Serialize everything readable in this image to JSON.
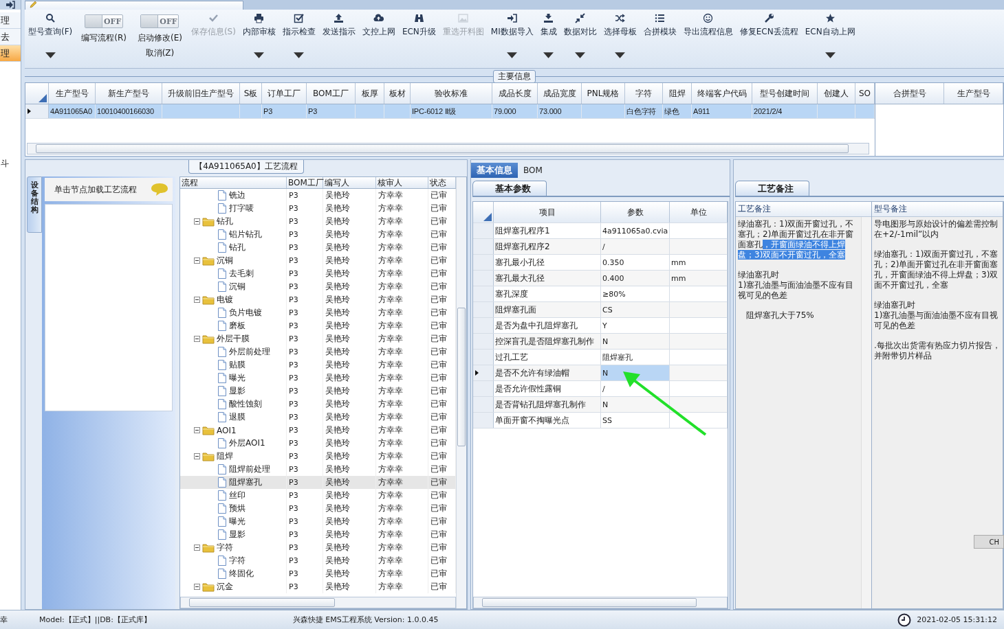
{
  "side_strip": {
    "items": [
      {
        "label": "理",
        "selected": false
      },
      {
        "label": "去",
        "selected": false
      },
      {
        "label": "理",
        "selected": true
      }
    ],
    "lower_label": "斗"
  },
  "toolbar": {
    "items": [
      {
        "kind": "button",
        "label": "型号查询(F)",
        "dropdown": true,
        "disabled": false
      },
      {
        "kind": "toggle",
        "switch_text": "OFF",
        "on": false,
        "label": "编写流程(R)"
      },
      {
        "kind": "toggle",
        "switch_text": "OFF",
        "on": false,
        "label": "启动修改(E)",
        "sublabel": "取消(Z)"
      },
      {
        "kind": "button",
        "label": "保存信息(S)",
        "dropdown": false,
        "disabled": true
      },
      {
        "kind": "button",
        "label": "内部审核",
        "dropdown": true,
        "disabled": false
      },
      {
        "kind": "button",
        "label": "指示检查",
        "dropdown": true,
        "disabled": false
      },
      {
        "kind": "button",
        "label": "发送指示",
        "dropdown": false,
        "disabled": false
      },
      {
        "kind": "button",
        "label": "文控上网",
        "dropdown": false,
        "disabled": false
      },
      {
        "kind": "button",
        "label": "ECN升级",
        "dropdown": false,
        "disabled": false
      },
      {
        "kind": "button",
        "label": "重选开料图",
        "dropdown": false,
        "disabled": true
      },
      {
        "kind": "button",
        "label": "MI数据导入",
        "dropdown": true,
        "disabled": false
      },
      {
        "kind": "button",
        "label": "集成",
        "dropdown": true,
        "disabled": false
      },
      {
        "kind": "button",
        "label": "数据对比",
        "dropdown": true,
        "disabled": false
      },
      {
        "kind": "button",
        "label": "选择母板",
        "dropdown": true,
        "disabled": false
      },
      {
        "kind": "button",
        "label": "合拼模块",
        "dropdown": false,
        "disabled": false
      },
      {
        "kind": "button",
        "label": "导出流程信息",
        "dropdown": false,
        "disabled": false
      },
      {
        "kind": "button",
        "label": "修复ECN丢流程",
        "dropdown": false,
        "disabled": false
      },
      {
        "kind": "button",
        "label": "ECN自动上网",
        "dropdown": true,
        "disabled": false
      }
    ]
  },
  "main_info": {
    "title": "主要信息",
    "row_selected": true,
    "columns": [
      {
        "label": "生产型号",
        "cell": "4A911065A0"
      },
      {
        "label": "新生产型号",
        "cell": "10010400166030"
      },
      {
        "label": "升级前旧生产型号"
      },
      {
        "label": "S板"
      },
      {
        "label": "订单工厂",
        "cell": "P3"
      },
      {
        "label": "BOM工厂",
        "cell": "P3"
      },
      {
        "label": "板厚"
      },
      {
        "label": "板材"
      },
      {
        "label": "验收标准",
        "cell": "IPC-6012 Ⅱ级"
      },
      {
        "label": "成品长度",
        "cell": "79.000"
      },
      {
        "label": "成品宽度",
        "cell": "73.000"
      },
      {
        "label": "PNL规格"
      },
      {
        "label": "字符",
        "cell": "白色字符"
      },
      {
        "label": "阻焊",
        "cell": "绿色"
      },
      {
        "label": "终端客户代码",
        "cell": "A911"
      },
      {
        "label": "型号创建时间",
        "cell": "2021/2/4"
      },
      {
        "label": "创建人"
      },
      {
        "label": "SO"
      }
    ],
    "merge_columns": [
      "合拼型号",
      "生产型号"
    ]
  },
  "flow": {
    "title": "【4A911065A0】工艺流程",
    "side_tab": "设备结构",
    "hint": "单击节点加载工艺流程",
    "columns": [
      "流程",
      "BOM工厂",
      "编写人",
      "核审人",
      "状态"
    ],
    "nodes": [
      {
        "kind": "step",
        "name": "铣边",
        "bom": "P3",
        "writer": "吴艳玲",
        "reviewer": "方幸幸",
        "status": "已审",
        "selected": false
      },
      {
        "kind": "step",
        "name": "打字唛",
        "bom": "P3",
        "writer": "吴艳玲",
        "reviewer": "方幸幸",
        "status": "已审",
        "selected": false
      },
      {
        "kind": "group",
        "name": "钻孔",
        "bom": "P3",
        "writer": "吴艳玲",
        "reviewer": "方幸幸",
        "status": "已审",
        "selected": false,
        "expanded": true,
        "children": [
          {
            "kind": "step",
            "name": "铝片钻孔",
            "bom": "P3",
            "writer": "吴艳玲",
            "reviewer": "方幸幸",
            "status": "已审",
            "selected": false
          },
          {
            "kind": "step",
            "name": "钻孔",
            "bom": "P3",
            "writer": "吴艳玲",
            "reviewer": "方幸幸",
            "status": "已审",
            "selected": false
          }
        ]
      },
      {
        "kind": "group",
        "name": "沉铜",
        "bom": "P3",
        "writer": "吴艳玲",
        "reviewer": "方幸幸",
        "status": "已审",
        "selected": false,
        "expanded": true,
        "children": [
          {
            "kind": "step",
            "name": "去毛刺",
            "bom": "P3",
            "writer": "吴艳玲",
            "reviewer": "方幸幸",
            "status": "已审",
            "selected": false
          },
          {
            "kind": "step",
            "name": "沉铜",
            "bom": "P3",
            "writer": "吴艳玲",
            "reviewer": "方幸幸",
            "status": "已审",
            "selected": false
          }
        ]
      },
      {
        "kind": "group",
        "name": "电镀",
        "bom": "P3",
        "writer": "吴艳玲",
        "reviewer": "方幸幸",
        "status": "已审",
        "selected": false,
        "expanded": true,
        "children": [
          {
            "kind": "step",
            "name": "负片电镀",
            "bom": "P3",
            "writer": "吴艳玲",
            "reviewer": "方幸幸",
            "status": "已审",
            "selected": false
          },
          {
            "kind": "step",
            "name": "磨板",
            "bom": "P3",
            "writer": "吴艳玲",
            "reviewer": "方幸幸",
            "status": "已审",
            "selected": false
          }
        ]
      },
      {
        "kind": "group",
        "name": "外层干膜",
        "bom": "P3",
        "writer": "吴艳玲",
        "reviewer": "方幸幸",
        "status": "已审",
        "selected": false,
        "expanded": true,
        "children": [
          {
            "kind": "step",
            "name": "外层前处理",
            "bom": "P3",
            "writer": "吴艳玲",
            "reviewer": "方幸幸",
            "status": "已审",
            "selected": false
          },
          {
            "kind": "step",
            "name": "贴膜",
            "bom": "P3",
            "writer": "吴艳玲",
            "reviewer": "方幸幸",
            "status": "已审",
            "selected": false
          },
          {
            "kind": "step",
            "name": "曝光",
            "bom": "P3",
            "writer": "吴艳玲",
            "reviewer": "方幸幸",
            "status": "已审",
            "selected": false
          },
          {
            "kind": "step",
            "name": "显影",
            "bom": "P3",
            "writer": "吴艳玲",
            "reviewer": "方幸幸",
            "status": "已审",
            "selected": false
          },
          {
            "kind": "step",
            "name": "酸性蚀刻",
            "bom": "P3",
            "writer": "吴艳玲",
            "reviewer": "方幸幸",
            "status": "已审",
            "selected": false
          },
          {
            "kind": "step",
            "name": "退膜",
            "bom": "P3",
            "writer": "吴艳玲",
            "reviewer": "方幸幸",
            "status": "已审",
            "selected": false
          }
        ]
      },
      {
        "kind": "group",
        "name": "AOI1",
        "bom": "P3",
        "writer": "吴艳玲",
        "reviewer": "方幸幸",
        "status": "已审",
        "selected": false,
        "expanded": true,
        "children": [
          {
            "kind": "step",
            "name": "外层AOI1",
            "bom": "P3",
            "writer": "吴艳玲",
            "reviewer": "方幸幸",
            "status": "已审",
            "selected": false
          }
        ]
      },
      {
        "kind": "group",
        "name": "阻焊",
        "bom": "P3",
        "writer": "吴艳玲",
        "reviewer": "方幸幸",
        "status": "已审",
        "selected": false,
        "expanded": true,
        "children": [
          {
            "kind": "step",
            "name": "阻焊前处理",
            "bom": "P3",
            "writer": "吴艳玲",
            "reviewer": "方幸幸",
            "status": "已审",
            "selected": false
          },
          {
            "kind": "step",
            "name": "阻焊塞孔",
            "bom": "P3",
            "writer": "吴艳玲",
            "reviewer": "方幸幸",
            "status": "已审",
            "selected": true
          },
          {
            "kind": "step",
            "name": "丝印",
            "bom": "P3",
            "writer": "吴艳玲",
            "reviewer": "方幸幸",
            "status": "已审",
            "selected": false
          },
          {
            "kind": "step",
            "name": "预烘",
            "bom": "P3",
            "writer": "吴艳玲",
            "reviewer": "方幸幸",
            "status": "已审",
            "selected": false
          },
          {
            "kind": "step",
            "name": "曝光",
            "bom": "P3",
            "writer": "吴艳玲",
            "reviewer": "方幸幸",
            "status": "已审",
            "selected": false
          },
          {
            "kind": "step",
            "name": "显影",
            "bom": "P3",
            "writer": "吴艳玲",
            "reviewer": "方幸幸",
            "status": "已审",
            "selected": false
          }
        ]
      },
      {
        "kind": "group",
        "name": "字符",
        "bom": "P3",
        "writer": "吴艳玲",
        "reviewer": "方幸幸",
        "status": "已审",
        "selected": false,
        "expanded": true,
        "children": [
          {
            "kind": "step",
            "name": "字符",
            "bom": "P3",
            "writer": "吴艳玲",
            "reviewer": "方幸幸",
            "status": "已审",
            "selected": false
          },
          {
            "kind": "step",
            "name": "终固化",
            "bom": "P3",
            "writer": "吴艳玲",
            "reviewer": "方幸幸",
            "status": "已审",
            "selected": false
          }
        ]
      },
      {
        "kind": "group",
        "name": "沉金",
        "bom": "P3",
        "writer": "吴艳玲",
        "reviewer": "方幸幸",
        "status": "已审",
        "selected": false,
        "expanded": true
      }
    ]
  },
  "params": {
    "tabs": [
      {
        "label": "基本信息",
        "selected": true
      },
      {
        "label": "BOM",
        "selected": false
      }
    ],
    "subtab": "基本参数",
    "columns": [
      "项目",
      "参数",
      "单位"
    ],
    "rows": [
      {
        "item": "阻焊塞孔程序1",
        "value": "4a911065a0.cvia",
        "selected": false
      },
      {
        "item": "阻焊塞孔程序2",
        "value": "/",
        "selected": false
      },
      {
        "item": "塞孔最小孔径",
        "value": "0.350",
        "unit": "mm",
        "selected": false
      },
      {
        "item": "塞孔最大孔径",
        "value": "0.400",
        "unit": "mm",
        "selected": false
      },
      {
        "item": "塞孔深度",
        "value": "≥80%",
        "selected": false
      },
      {
        "item": "阻焊塞孔面",
        "value": "CS",
        "selected": false
      },
      {
        "item": "是否为盘中孔阻焊塞孔",
        "value": "Y",
        "selected": false
      },
      {
        "item": "控深盲孔是否阻焊塞孔制作",
        "value": "N",
        "selected": false
      },
      {
        "item": "过孔工艺",
        "value": "阻焊塞孔",
        "selected": false
      },
      {
        "item": "是否不允许有绿油帽",
        "value": "N",
        "selected": true
      },
      {
        "item": "是否允许假性露铜",
        "value": "/",
        "selected": false
      },
      {
        "item": "是否背钻孔阻焊塞孔制作",
        "value": "N",
        "selected": false
      },
      {
        "item": "单面开窗不掏曝光点",
        "value": "SS",
        "selected": false
      }
    ]
  },
  "notes": {
    "subtab": "工艺备注",
    "columns": [
      {
        "header": "工艺备注",
        "paragraphs": [
          {
            "segments": [
              {
                "text": "绿油塞孔：1)双面开窗过孔，不塞孔；2)单面开窗过孔在非开窗面塞孔",
                "highlighted": false
              },
              {
                "text": "，开窗面绿油不得上焊盘；3)双面不开窗过孔，全塞",
                "highlighted": true
              }
            ]
          },
          {
            "segments": [
              {
                "text": "绿油塞孔时\n1)塞孔油墨与面油油墨不应有目视可见的色差",
                "highlighted": false
              }
            ]
          },
          {
            "segments": [
              {
                "text": "阻焊塞孔大于75%",
                "highlighted": false
              }
            ],
            "indent": true
          }
        ]
      },
      {
        "header": "型号备注",
        "paragraphs": [
          {
            "segments": [
              {
                "text": "导电图形与原始设计的偏差需控制在+2/-1mil”以内",
                "highlighted": false
              }
            ]
          },
          {
            "segments": [
              {
                "text": "绿油塞孔：1)双面开窗过孔，不塞孔；2)单面开窗过孔在非开窗面塞孔，开窗面绿油不得上焊盘；3)双面不开窗过孔，全塞",
                "highlighted": false
              }
            ]
          },
          {
            "segments": [
              {
                "text": "绿油塞孔时\n1)塞孔油墨与面油油墨不应有目视可见的色差",
                "highlighted": false
              }
            ]
          },
          {
            "segments": [
              {
                "text": ".每批次出货需有热应力切片报告，并附带切片样品",
                "highlighted": false
              }
            ]
          }
        ]
      }
    ],
    "ime": "CH"
  },
  "status_bar": {
    "cut_left": "幸",
    "model": "Model:【正式】||DB:【正式库】",
    "app": "兴森快捷 EMS工程系统 Version: 1.0.0.45",
    "datetime": "2021-02-05 15:31:12"
  }
}
